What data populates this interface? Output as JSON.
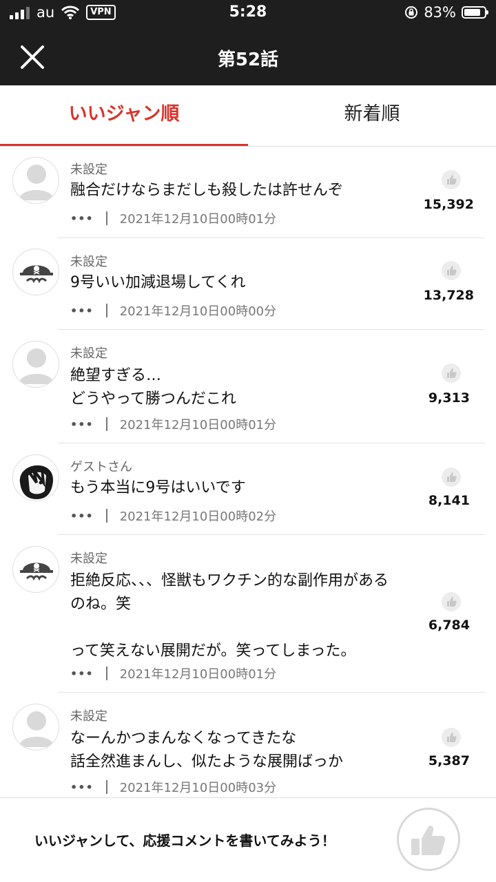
{
  "status_bar": {
    "carrier": "au",
    "vpn": "VPN",
    "time": "5:28",
    "battery_text": "83%",
    "battery_level": 0.83
  },
  "nav": {
    "title": "第52話",
    "close_icon": "close-icon"
  },
  "tabs": [
    {
      "label": "いいジャン順",
      "active": true
    },
    {
      "label": "新着順",
      "active": false
    }
  ],
  "comments": [
    {
      "user": "未設定",
      "avatar": "default-avatar",
      "text": "融合だけならまだしも殺したは許せんぞ",
      "more": "•••",
      "date": "2021年12月10日00時01分",
      "likes": "15,392"
    },
    {
      "user": "未設定",
      "avatar": "pirate-avatar",
      "text": "9号いい加減退場してくれ",
      "more": "•••",
      "date": "2021年12月10日00時00分",
      "likes": "13,728"
    },
    {
      "user": "未設定",
      "avatar": "default-avatar",
      "text": "絶望すぎる…\nどうやって勝つんだこれ",
      "more": "•••",
      "date": "2021年12月10日00時01分",
      "likes": "9,313"
    },
    {
      "user": "ゲストさん",
      "avatar": "manga-avatar",
      "text": "もう本当に9号はいいです",
      "more": "•••",
      "date": "2021年12月10日00時02分",
      "likes": "8,141"
    },
    {
      "user": "未設定",
      "avatar": "pirate-avatar",
      "text": "拒絶反応、、、怪獣もワクチン的な副作用があるのね。笑\n\nって笑えない展開だが。笑ってしまった。",
      "more": "•••",
      "date": "2021年12月10日00時01分",
      "likes": "6,784"
    },
    {
      "user": "未設定",
      "avatar": "default-avatar",
      "text": "なーんかつまんなくなってきたな\n話全然進まんし、似たような展開ばっか",
      "more": "•••",
      "date": "2021年12月10日00時03分",
      "likes": "5,387"
    }
  ],
  "bottom": {
    "prompt": "いいジャンして、応援コメントを書いてみよう！",
    "button_icon": "thumbs-up-icon"
  },
  "colors": {
    "accent": "#d8332b",
    "header_bg": "#1e1e1e"
  }
}
